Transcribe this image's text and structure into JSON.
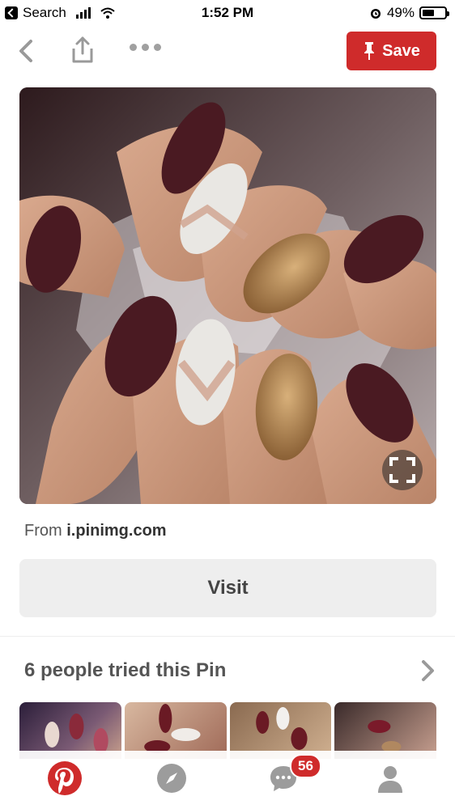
{
  "status_bar": {
    "back_app": "Search",
    "time": "1:52 PM",
    "battery": "49%"
  },
  "toolbar": {
    "save_label": "Save"
  },
  "pin": {
    "source_prefix": "From",
    "source_domain": "i.pinimg.com",
    "visit_label": "Visit"
  },
  "tried": {
    "title": "6 people tried this Pin"
  },
  "tab_bar": {
    "tabs": [
      {
        "icon": "pinterest-logo-icon"
      },
      {
        "icon": "compass-icon"
      },
      {
        "icon": "chat-icon"
      },
      {
        "icon": "profile-icon"
      }
    ],
    "notifications_badge": "56"
  },
  "colors": {
    "accent_red": "#cf2b2b",
    "visit_bg": "#eeeeee"
  }
}
